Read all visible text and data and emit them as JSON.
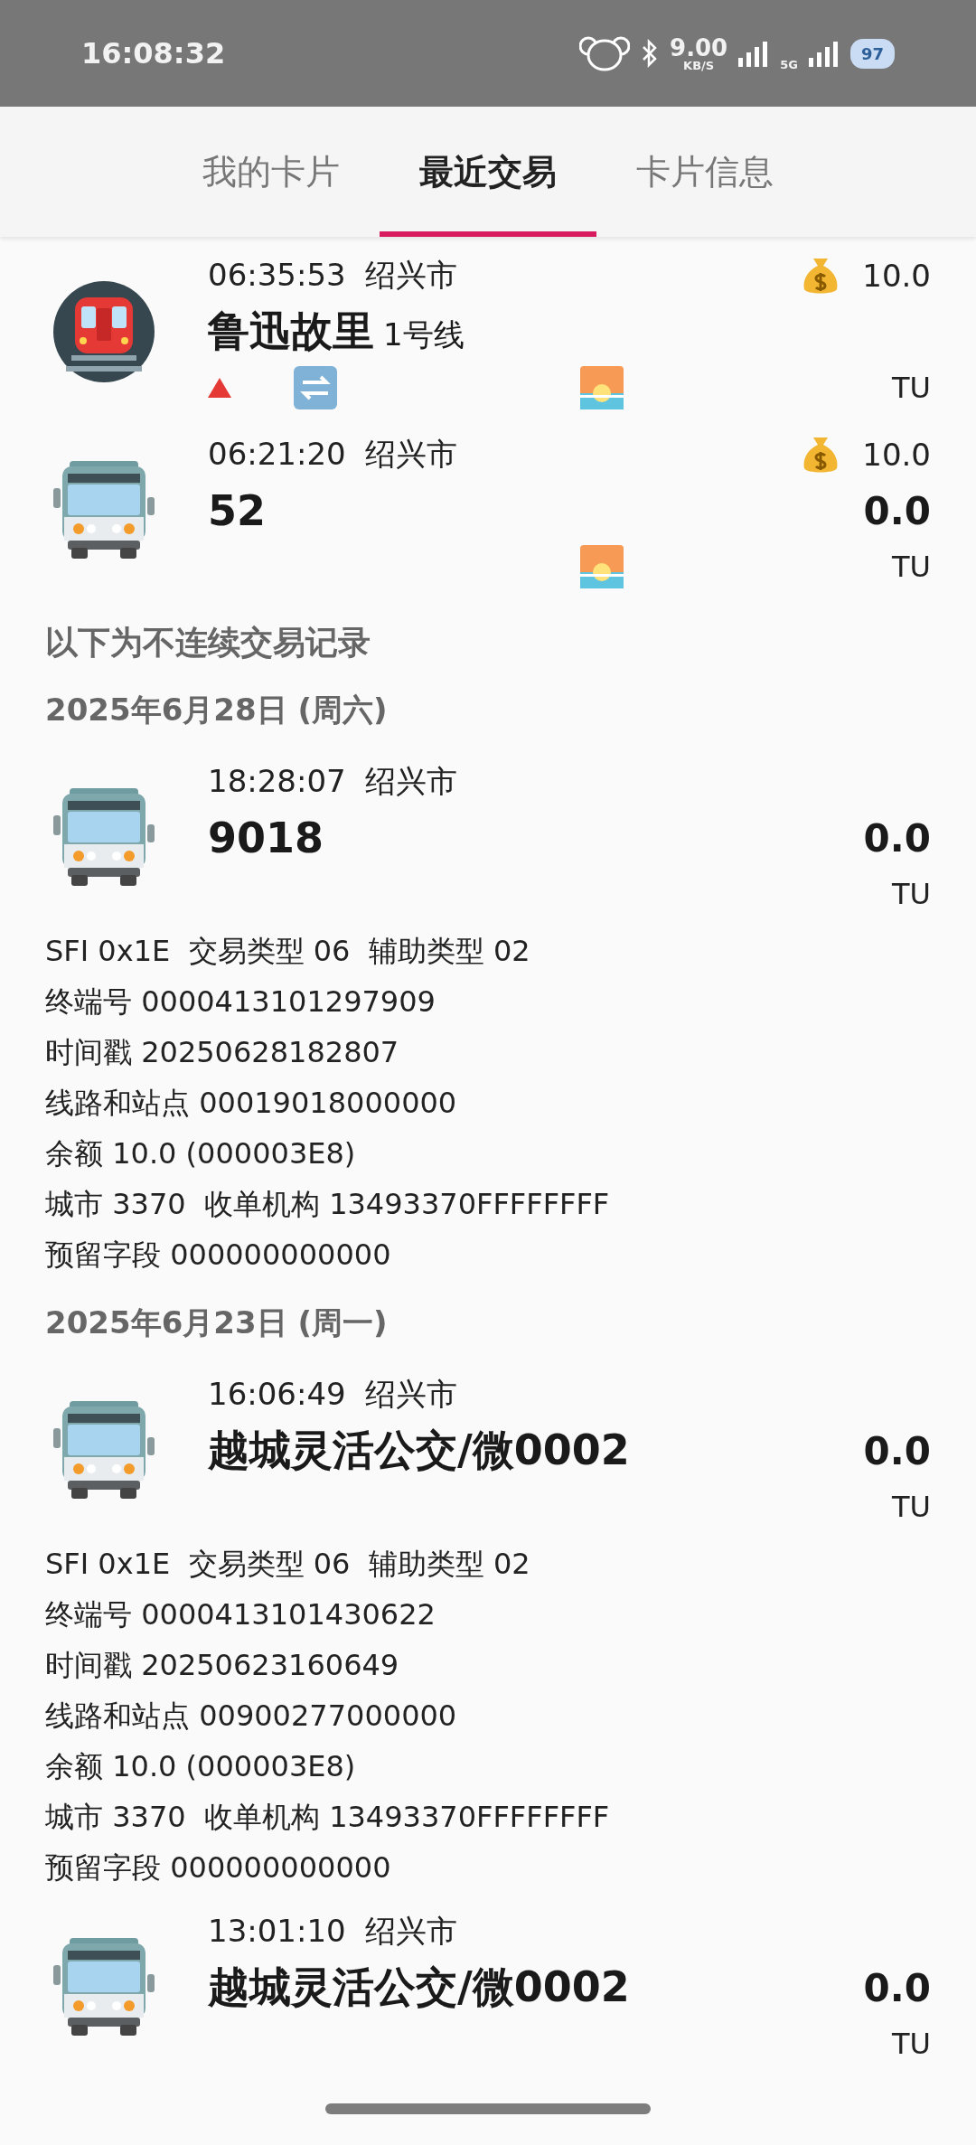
{
  "status_bar": {
    "time": "16:08:32",
    "network_speed": "9.00",
    "speed_unit": "KB/S",
    "network_type": "5G",
    "battery": "97"
  },
  "tabs": [
    {
      "label": "我的卡片",
      "selected": false
    },
    {
      "label": "最近交易",
      "selected": true
    },
    {
      "label": "卡片信息",
      "selected": false
    }
  ],
  "recent_records": [
    {
      "kind": "metro",
      "time": "06:35:53",
      "city": "绍兴市",
      "title": "鲁迅故里",
      "title_suffix": "1号线",
      "charge": "10.0",
      "unit": "TU",
      "markers": [
        {
          "kind": "up"
        },
        {
          "kind": "transfer"
        },
        {
          "kind": "sunrise"
        }
      ]
    },
    {
      "kind": "bus",
      "time": "06:21:20",
      "city": "绍兴市",
      "title": "52",
      "charge": "10.0",
      "amount": "0.0",
      "unit": "TU",
      "markers": [
        {
          "kind": "sunrise"
        }
      ]
    }
  ],
  "section_note": "以下为不连续交易记录",
  "groups": [
    {
      "date": "2025年6月28日 (周六)",
      "records": [
        {
          "kind": "bus",
          "time": "18:28:07",
          "city": "绍兴市",
          "title": "9018",
          "amount": "0.0",
          "unit": "TU",
          "details": [
            "SFI 0x1E  交易类型 06  辅助类型 02",
            "终端号 0000413101297909",
            "时间戳 20250628182807",
            "线路和站点 00019018000000",
            "余额 10.0 (000003E8)",
            "城市 3370  收单机构 13493370FFFFFFFF",
            "预留字段 000000000000"
          ]
        }
      ]
    },
    {
      "date": "2025年6月23日 (周一)",
      "records": [
        {
          "kind": "bus",
          "time": "16:06:49",
          "city": "绍兴市",
          "title": "越城灵活公交/微0002",
          "amount": "0.0",
          "unit": "TU",
          "details": [
            "SFI 0x1E  交易类型 06  辅助类型 02",
            "终端号 0000413101430622",
            "时间戳 20250623160649",
            "线路和站点 00900277000000",
            "余额 10.0 (000003E8)",
            "城市 3370  收单机构 13493370FFFFFFFF",
            "预留字段 000000000000"
          ]
        },
        {
          "kind": "bus",
          "time": "13:01:10",
          "city": "绍兴市",
          "title": "越城灵活公交/微0002",
          "amount": "0.0",
          "unit": "TU"
        }
      ]
    }
  ]
}
